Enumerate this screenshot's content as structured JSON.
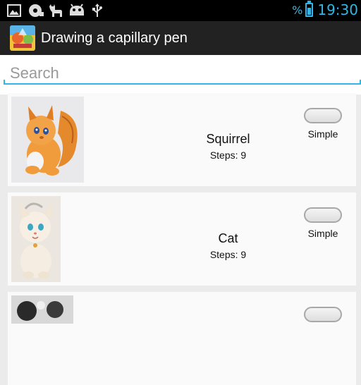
{
  "status_bar": {
    "notification_icons": [
      "image-icon",
      "disk-icon",
      "cat-icon",
      "android-icon",
      "usb-icon"
    ],
    "battery_text": "%",
    "time": "19:30",
    "accent_color": "#33b5e5"
  },
  "action_bar": {
    "title": "Drawing a capillary pen",
    "icon": "app-icon"
  },
  "search": {
    "placeholder": "Search",
    "value": ""
  },
  "items": [
    {
      "name": "Squirrel",
      "steps": "Steps: 9",
      "level": "Simple",
      "thumbnail": "squirrel-drawing"
    },
    {
      "name": "Cat",
      "steps": "Steps: 9",
      "level": "Simple",
      "thumbnail": "cat-drawing"
    },
    {
      "name": "",
      "steps": "",
      "level": "",
      "thumbnail": "drawing-partial"
    }
  ]
}
